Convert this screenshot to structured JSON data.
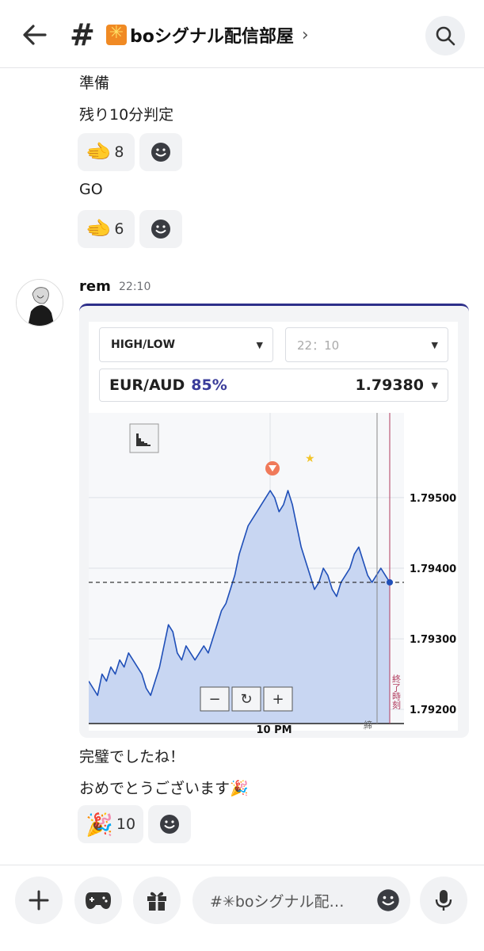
{
  "header": {
    "hash": "#",
    "channel_name": "boシグナル配信部屋",
    "chevron": "›"
  },
  "messages_top": [
    {
      "text": "準備"
    },
    {
      "text": "残り10分判定",
      "reaction": {
        "emoji": "🫲",
        "count": "8"
      }
    },
    {
      "text": "GO",
      "reaction": {
        "emoji": "🫲",
        "count": "6"
      }
    }
  ],
  "post": {
    "username": "rem",
    "time": "22:10"
  },
  "trade_panel": {
    "option_type": "HIGH/LOW",
    "expiry": "22：10",
    "pair": "EUR/AUD",
    "payout": "85%",
    "rate": "1.79380"
  },
  "chart_data": {
    "type": "area",
    "title": "",
    "xlabel": "",
    "ylabel": "",
    "x_tick_label": "10 PM",
    "y_ticks": [
      "1.79500",
      "1.79400",
      "1.79300",
      "1.79200"
    ],
    "ylim": [
      1.7918,
      1.7962
    ],
    "current_rate": 1.7938,
    "close_label": "締切",
    "end_label": "終了時刻",
    "series": [
      {
        "values": [
          1.7924,
          1.7923,
          1.7922,
          1.7925,
          1.7924,
          1.7926,
          1.7925,
          1.7927,
          1.7926,
          1.7928,
          1.7927,
          1.7926,
          1.7925,
          1.7923,
          1.7922,
          1.7924,
          1.7926,
          1.7929,
          1.7932,
          1.7931,
          1.7928,
          1.7927,
          1.7929,
          1.7928,
          1.7927,
          1.7928,
          1.7929,
          1.7928,
          1.793,
          1.7932,
          1.7934,
          1.7935,
          1.7937,
          1.7939,
          1.7942,
          1.7944,
          1.7946,
          1.7947,
          1.7948,
          1.7949,
          1.795,
          1.7951,
          1.795,
          1.7948,
          1.7949,
          1.7951,
          1.7949,
          1.7946,
          1.7943,
          1.7941,
          1.7939,
          1.7937,
          1.7938,
          1.794,
          1.7939,
          1.7937,
          1.7936,
          1.7938,
          1.7939,
          1.794,
          1.7942,
          1.7943,
          1.7941,
          1.7939,
          1.7938,
          1.7939,
          1.794,
          1.7939,
          1.7938
        ]
      }
    ]
  },
  "chart_controls": {
    "minus": "−",
    "reset": "↻",
    "plus": "+"
  },
  "messages_bottom": [
    {
      "text": "完璧でしたね！"
    },
    {
      "text": "おめでとうございます🎉",
      "reaction": {
        "emoji": "🎉",
        "count": "10"
      }
    }
  ],
  "composer": {
    "placeholder": "#✳boシグナル配…"
  },
  "colors": {
    "accent_navy": "#2d2f8a",
    "chart_line": "#1f4fb8",
    "chart_fill": "#c8d6f2",
    "sell_marker": "#f07a5a"
  }
}
